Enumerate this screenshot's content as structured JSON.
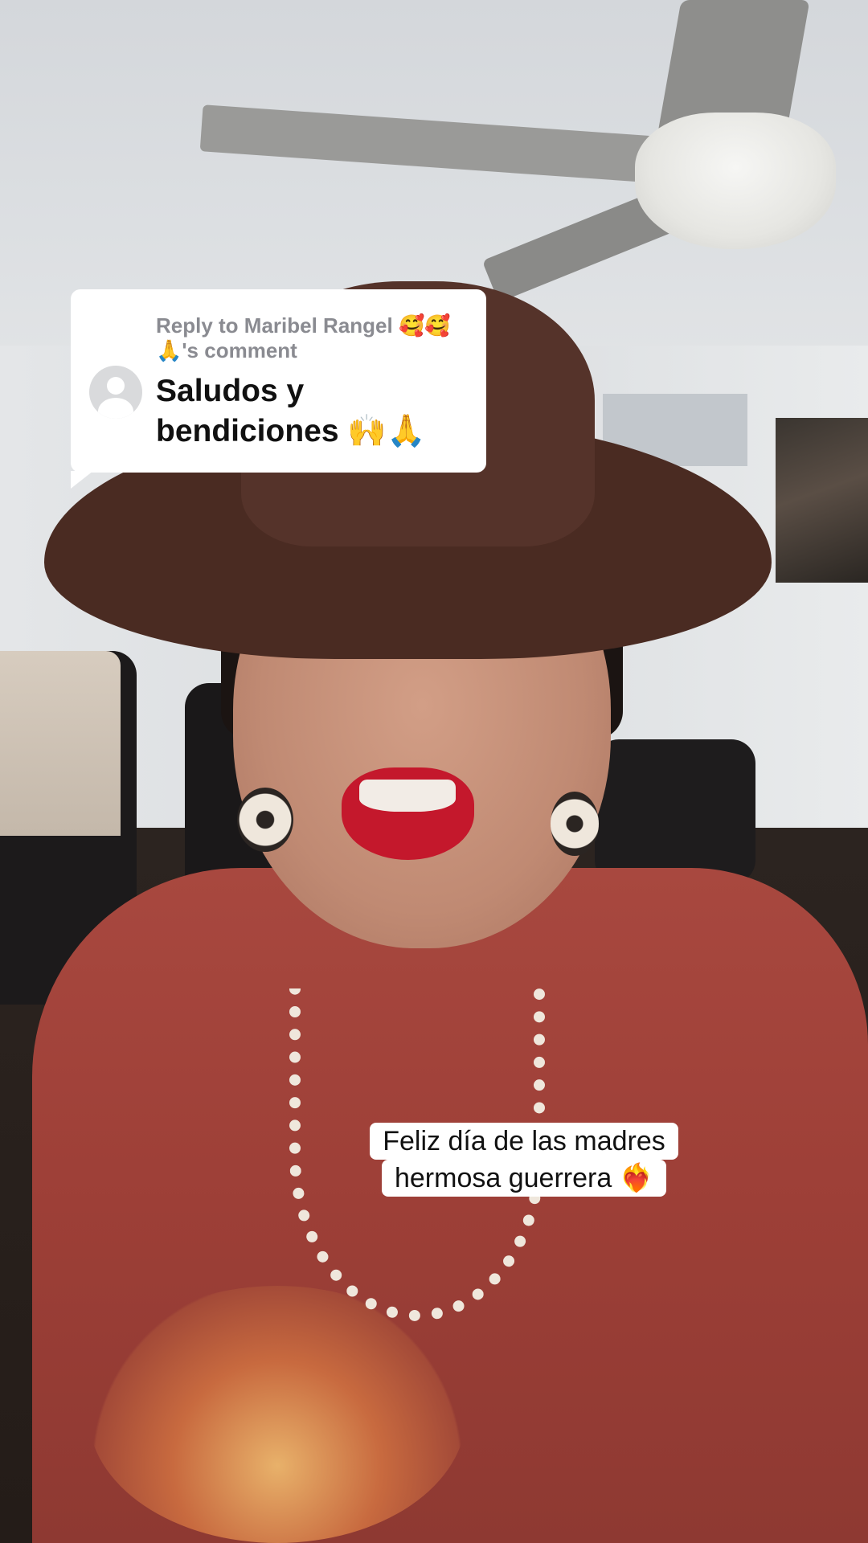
{
  "reply_card": {
    "header": "Reply to Maribel Rangel 🥰🥰🙏's comment",
    "comment": "Saludos y bendiciones 🙌🙏"
  },
  "caption": {
    "line1": "Feliz día de las madres",
    "line2": "hermosa guerrera ❤️‍🔥"
  },
  "colors": {
    "bubble_background": "#ffffff",
    "meta_text": "#8a8b91",
    "comment_text": "#111111"
  },
  "icons": {
    "avatar": "default-user-avatar-icon"
  }
}
